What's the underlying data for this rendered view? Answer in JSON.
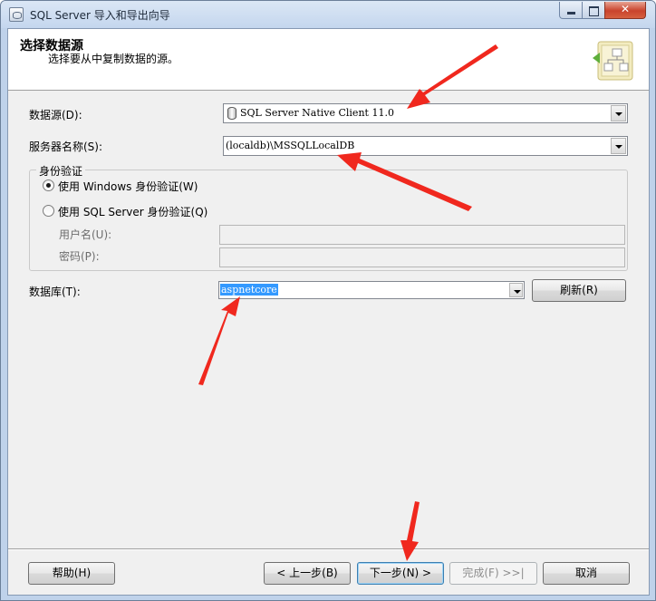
{
  "window": {
    "title": "SQL Server 导入和导出向导"
  },
  "header": {
    "title": "选择数据源",
    "subtitle": "选择要从中复制数据的源。"
  },
  "form": {
    "datasource_label": "数据源(D):",
    "datasource_value": "SQL Server Native Client 11.0",
    "server_label": "服务器名称(S):",
    "server_value": "(localdb)\\MSSQLLocalDB",
    "auth_group_label": "身份验证",
    "auth_windows_label": "使用 Windows 身份验证(W)",
    "auth_sql_label": "使用 SQL Server 身份验证(Q)",
    "auth_selected": "windows",
    "username_label": "用户名(U):",
    "username_value": "",
    "password_label": "密码(P):",
    "password_value": "",
    "database_label": "数据库(T):",
    "database_value": "aspnetcore",
    "refresh_label": "刷新(R)"
  },
  "footer": {
    "help_label": "帮助(H)",
    "back_label": "< 上一步(B)",
    "next_label": "下一步(N) >",
    "finish_label": "完成(F) >>|",
    "cancel_label": "取消"
  },
  "colors": {
    "annotation_arrow": "#f0281e",
    "selection": "#3399ff"
  }
}
